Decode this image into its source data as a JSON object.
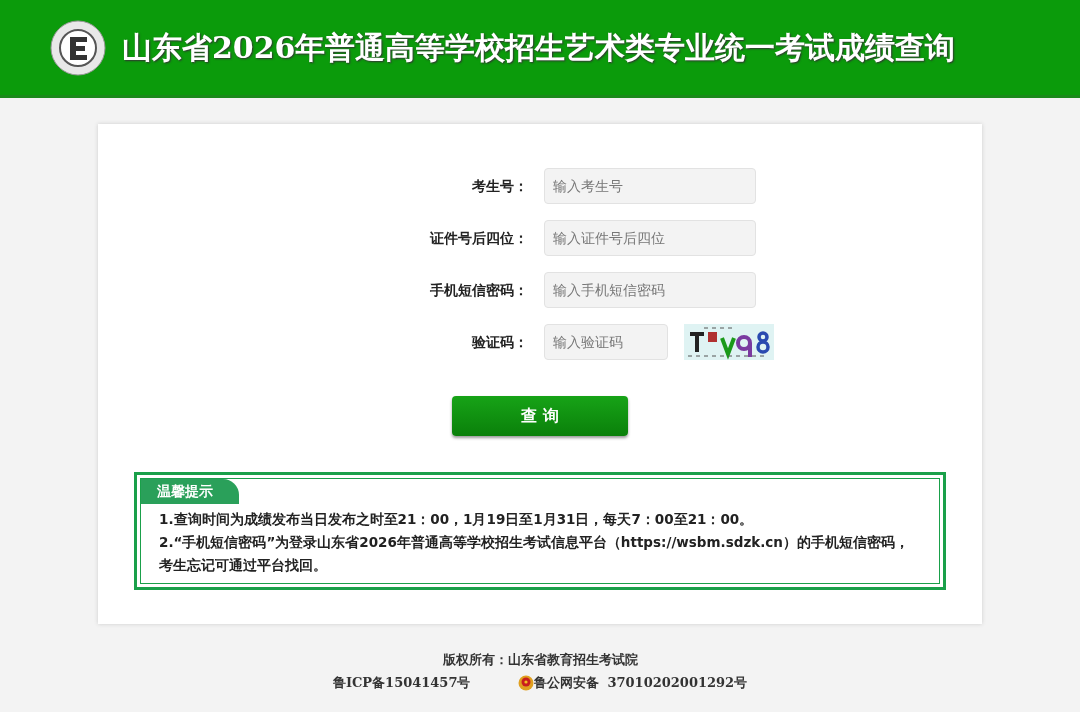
{
  "header": {
    "title": "山东省2026年普通高等学校招生艺术类专业统一考试成绩查询"
  },
  "form": {
    "fields": [
      {
        "label": "考生号：",
        "placeholder": "输入考生号",
        "kind": "text"
      },
      {
        "label": "证件号后四位：",
        "placeholder": "输入证件号后四位",
        "kind": "text"
      },
      {
        "label": "手机短信密码：",
        "placeholder": "输入手机短信密码",
        "kind": "text"
      },
      {
        "label": "验证码：",
        "placeholder": "输入验证码",
        "kind": "captcha"
      }
    ],
    "submit": "查 询"
  },
  "notice": {
    "title": "温馨提示",
    "items": [
      "1.查询时间为成绩发布当日发布之时至21：00，1月19日至1月31日，每天7：00至21：00。",
      "2.“手机短信密码”为登录山东省2026年普通高等学校招生考试信息平台（https://wsbm.sdzk.cn）的手机短信密码，考生忘记可通过平台找回。"
    ]
  },
  "footer": {
    "copyright": "版权所有：山东省教育招生考试院",
    "icp": "鲁ICP备15041457号",
    "police": "鲁公网安备",
    "police_number": "37010202001292号"
  }
}
